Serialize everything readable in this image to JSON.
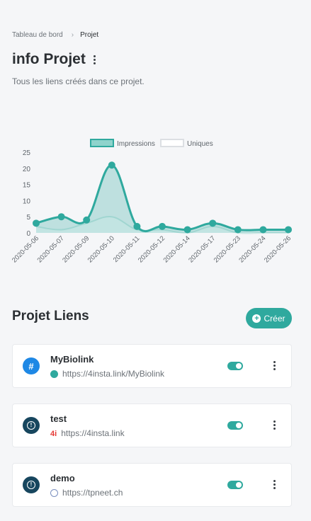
{
  "breadcrumb": {
    "home": "Tableau de bord",
    "separator": "›",
    "current": "Projet"
  },
  "header": {
    "title": "info Projet",
    "subtitle": "Tous les liens créés dans ce projet."
  },
  "chart_data": {
    "type": "line",
    "categories": [
      "2020-05-06",
      "2020-05-07",
      "2020-05-09",
      "2020-05-10",
      "2020-05-11",
      "2020-05-12",
      "2020-05-14",
      "2020-05-17",
      "2020-05-23",
      "2020-05-24",
      "2020-05-26"
    ],
    "series": [
      {
        "name": "Impressions",
        "values": [
          3,
          5,
          4,
          21,
          2,
          2,
          1,
          3,
          1,
          1,
          1
        ],
        "color": "#2fa99e"
      },
      {
        "name": "Uniques",
        "values": [
          2,
          1,
          3,
          5,
          1,
          1,
          0,
          2,
          0,
          0,
          0
        ],
        "color": "#ffffff"
      }
    ],
    "yticks": [
      "0",
      "5",
      "10",
      "15",
      "20",
      "25"
    ],
    "ylim": [
      0,
      25
    ],
    "legend": "top-center",
    "grid": false
  },
  "links_section": {
    "title": "Projet Liens",
    "create_label": "Créer"
  },
  "links": [
    {
      "name": "MyBiolink",
      "url": "https://4insta.link/MyBiolink",
      "icon": "hash-icon",
      "enabled": true
    },
    {
      "name": "test",
      "url": "https://4insta.link",
      "icon": "alert-icon",
      "enabled": true
    },
    {
      "name": "demo",
      "url": "https://tpneet.ch",
      "icon": "alert-icon",
      "enabled": true
    }
  ],
  "icons": {
    "link_type_hash": "#",
    "link_type_alert": "!",
    "plus": "+",
    "favicon_4insta": "4i"
  }
}
